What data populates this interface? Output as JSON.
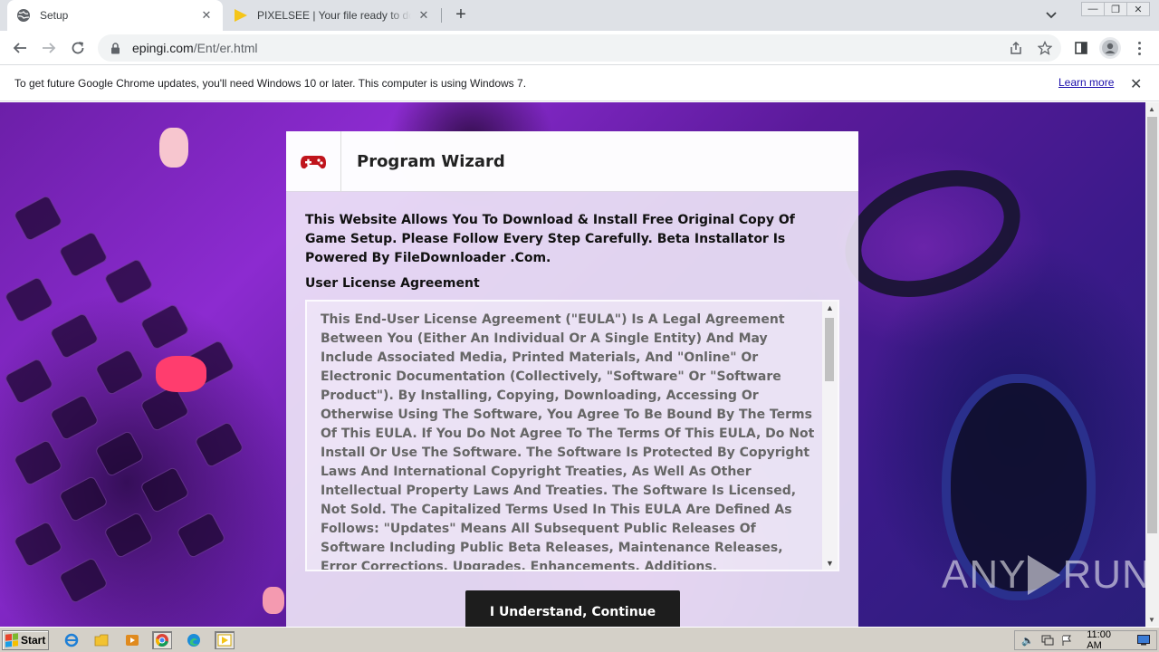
{
  "tabs": [
    {
      "title": "Setup",
      "icon": "globe-icon",
      "active": true
    },
    {
      "title": "PIXELSEE | Your file ready to download",
      "icon": "pixelsee-play-icon",
      "active": false
    }
  ],
  "address": {
    "host": "epingi.com",
    "path": "/Ent/er.html"
  },
  "infobar": {
    "message": "To get future Google Chrome updates, you'll need Windows 10 or later. This computer is using Windows 7.",
    "learn_more": "Learn more"
  },
  "wizard": {
    "title": "Program Wizard",
    "icon": "gamepad-icon",
    "intro": "This Website Allows You To Download & Install Free Original Copy Of Game Setup. Please Follow Every Step Carefully. Beta Installator Is Powered By FileDownloader .Com.",
    "eula_label": "User License Agreement",
    "eula_text": "This End-User License Agreement (\"EULA\") Is A Legal Agreement Between You (Either An Individual Or A Single Entity) And May Include Associated Media, Printed Materials, And \"Online\" Or Electronic Documentation (Collectively, \"Software\" Or \"Software Product\"). By Installing, Copying, Downloading, Accessing Or Otherwise Using The Software, You Agree To Be Bound By The Terms Of This EULA. If You Do Not Agree To The Terms Of This EULA, Do Not Install Or Use The Software. The Software Is Protected By Copyright Laws And International Copyright Treaties, As Well As Other Intellectual Property Laws And Treaties. The Software Is Licensed, Not Sold. The Capitalized Terms Used In This EULA Are Defined As Follows: \"Updates\" Means All Subsequent Public Releases Of Software Including Public Beta Releases, Maintenance Releases, Error Corrections, Upgrades, Enhancements, Additions, Improvements, Extensions, Modifications And Successor Versions. Limitations On Reverse Engineering, Decompilation, And Disassembly. You May Not Reverse Engineer",
    "continue_label": "I Understand, Continue"
  },
  "watermark": {
    "left": "ANY",
    "right": "RUN"
  },
  "taskbar": {
    "start_label": "Start",
    "clock": "11:00 AM"
  },
  "colors": {
    "accent_red": "#c0141c",
    "button_bg": "#1d1d1d"
  }
}
